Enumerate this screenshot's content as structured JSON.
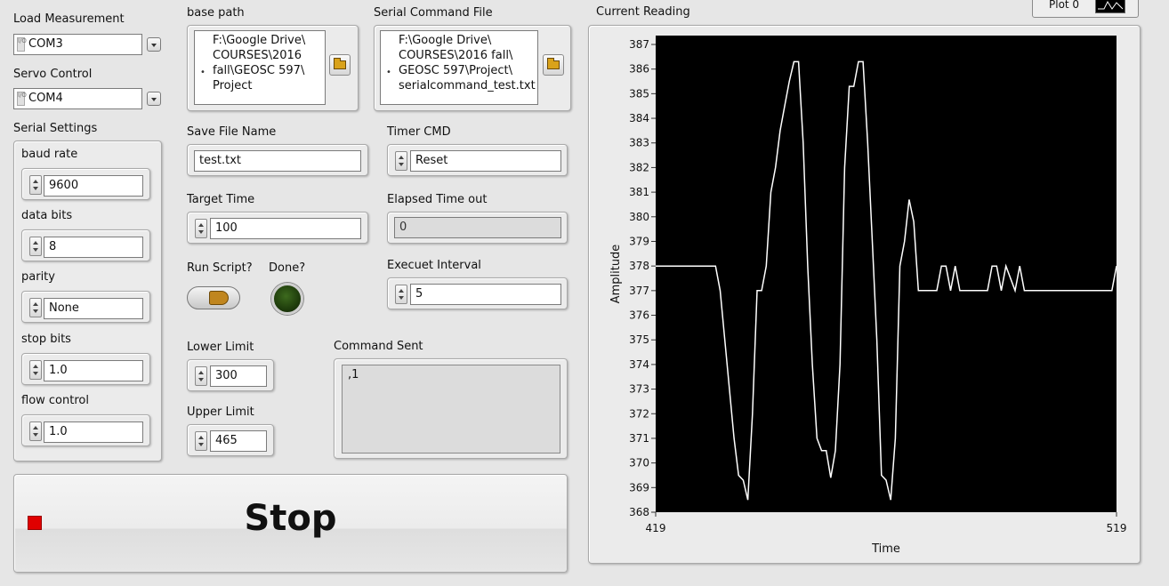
{
  "load_measurement": {
    "label": "Load Measurement",
    "value": "COM3"
  },
  "servo_control": {
    "label": "Servo Control",
    "value": "COM4"
  },
  "serial_settings": {
    "label": "Serial Settings",
    "baud_rate": {
      "label": "baud rate",
      "value": "9600"
    },
    "data_bits": {
      "label": "data bits",
      "value": "8"
    },
    "parity": {
      "label": "parity",
      "value": "None"
    },
    "stop_bits": {
      "label": "stop bits",
      "value": "1.0"
    },
    "flow_control": {
      "label": "flow control",
      "value": "1.0"
    }
  },
  "base_path": {
    "label": "base path",
    "lines": [
      "F:\\Google Drive\\",
      "COURSES\\2016",
      "fall\\GEOSC 597\\",
      "Project"
    ]
  },
  "serial_command_file": {
    "label": "Serial Command File",
    "lines": [
      "F:\\Google Drive\\",
      "COURSES\\2016 fall\\",
      "GEOSC 597\\Project\\",
      "serialcommand_test.txt"
    ]
  },
  "save_file_name": {
    "label": "Save File Name",
    "value": "test.txt"
  },
  "timer_cmd": {
    "label": "Timer CMD",
    "value": "Reset"
  },
  "target_time": {
    "label": "Target Time",
    "value": "100"
  },
  "elapsed_time_out": {
    "label": "Elapsed Time out",
    "value": "0"
  },
  "run_script": {
    "label": "Run Script?"
  },
  "done": {
    "label": "Done?"
  },
  "execute_interval": {
    "label": "Execuet Interval",
    "value": "5"
  },
  "lower_limit": {
    "label": "Lower Limit",
    "value": "300"
  },
  "upper_limit": {
    "label": "Upper Limit",
    "value": "465"
  },
  "command_sent": {
    "label": "Command Sent",
    "value": ",1"
  },
  "stop_button": {
    "label": "Stop"
  },
  "chart_panel": {
    "label": "Current Reading",
    "legend": "Plot 0"
  },
  "colors": {
    "plot_bg": "#000000",
    "trace": "#ffffff",
    "stop_led": "#e00000",
    "done_led": "#1f3d0c"
  },
  "chart_data": {
    "type": "line",
    "title": "Current Reading",
    "xlabel": "Time",
    "ylabel": "Amplitude",
    "xlim": [
      419,
      519
    ],
    "ylim": [
      368,
      387
    ],
    "x_ticks": [
      "419",
      "519"
    ],
    "y_ticks": [
      "368",
      "369",
      "370",
      "371",
      "372",
      "373",
      "374",
      "375",
      "376",
      "377",
      "378",
      "379",
      "380",
      "381",
      "382",
      "383",
      "384",
      "385",
      "386",
      "387"
    ],
    "legend": "top-right",
    "series": [
      {
        "name": "Plot 0",
        "x": [
          419,
          422,
          425,
          428,
          430,
          432,
          433,
          434,
          435,
          436,
          437,
          438,
          439,
          440,
          441,
          442,
          443,
          444,
          445,
          446,
          447,
          448,
          449,
          450,
          451,
          452,
          453,
          454,
          455,
          456,
          457,
          458,
          459,
          460,
          461,
          462,
          463,
          464,
          465,
          466,
          467,
          468,
          469,
          470,
          471,
          472,
          473,
          474,
          475,
          476,
          477,
          478,
          479,
          480,
          481,
          482,
          483,
          484,
          485,
          486,
          487,
          488,
          489,
          490,
          491,
          492,
          493,
          494,
          495,
          497,
          498,
          499,
          500,
          501,
          502,
          503,
          504,
          505,
          506,
          507,
          508,
          509,
          510,
          512,
          514,
          516,
          518,
          519
        ],
        "y": [
          378,
          378,
          378,
          378,
          378,
          378,
          377,
          375,
          373,
          371,
          369.5,
          369.3,
          368.5,
          372,
          377,
          377,
          378,
          381,
          382,
          383.5,
          384.5,
          385.5,
          386.3,
          386.3,
          383,
          378,
          374,
          371,
          370.5,
          370.5,
          369.4,
          370.5,
          374,
          382,
          385.3,
          385.3,
          386.3,
          386.3,
          383,
          379,
          375,
          369.5,
          369.3,
          368.5,
          371,
          378,
          379,
          380.7,
          379.8,
          377,
          377,
          377,
          377,
          377,
          378,
          378,
          377,
          378,
          377,
          377,
          377,
          377,
          377,
          377,
          377,
          378,
          378,
          377,
          378,
          377,
          378,
          377,
          377,
          377,
          377,
          377,
          377,
          377,
          377,
          377,
          377,
          377,
          377,
          377,
          377,
          377,
          377,
          378
        ]
      }
    ]
  }
}
